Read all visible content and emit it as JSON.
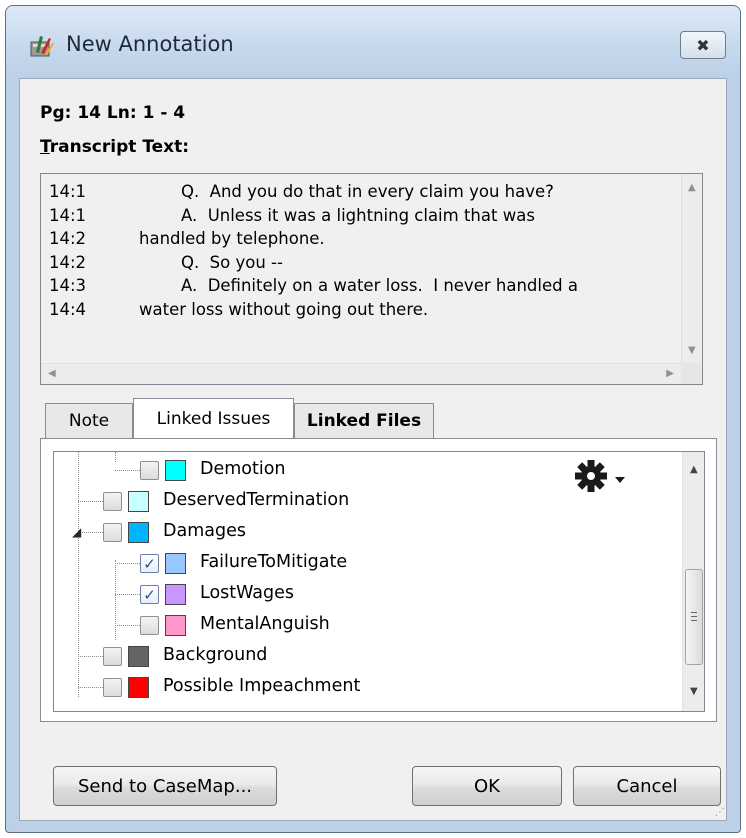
{
  "window": {
    "title": "New Annotation",
    "close_glyph": "✖"
  },
  "page_line": "Pg: 14 Ln: 1 - 4",
  "transcript_label_underlined": "T",
  "transcript_label_rest": "ranscript Text:",
  "transcript": [
    {
      "ln": "14:1",
      "text": "        Q.  And you do that in every claim you have?"
    },
    {
      "ln": "14:1",
      "text": "        A.  Unless it was a lightning claim that was"
    },
    {
      "ln": "14:2",
      "text": "handled by telephone."
    },
    {
      "ln": "14:2",
      "text": "        Q.  So you --"
    },
    {
      "ln": "14:3",
      "text": "        A.  Definitely on a water loss.  I never handled a"
    },
    {
      "ln": "14:4",
      "text": "water loss without going out there."
    }
  ],
  "tabs": {
    "note": "Note",
    "linked_issues": "Linked Issues",
    "linked_files": "Linked Files"
  },
  "issues": [
    {
      "label": "Demotion",
      "color": "#00ffff",
      "checked": false
    },
    {
      "label": "DeservedTermination",
      "color": "#c8ffff",
      "checked": false
    },
    {
      "label": "Damages",
      "color": "#00b4ff",
      "checked": false
    },
    {
      "label": "FailureToMitigate",
      "color": "#96c8ff",
      "checked": true
    },
    {
      "label": "LostWages",
      "color": "#c896ff",
      "checked": true
    },
    {
      "label": "MentalAnguish",
      "color": "#ff96c8",
      "checked": false
    },
    {
      "label": "Background",
      "color": "#646464",
      "checked": false
    },
    {
      "label": "Possible Impeachment",
      "color": "#ff0000",
      "checked": false
    }
  ],
  "icons": {
    "app": "annotation-app-icon",
    "gear": "gear-icon"
  },
  "buttons": {
    "send": "Send to CaseMap...",
    "ok": "OK",
    "cancel": "Cancel"
  }
}
